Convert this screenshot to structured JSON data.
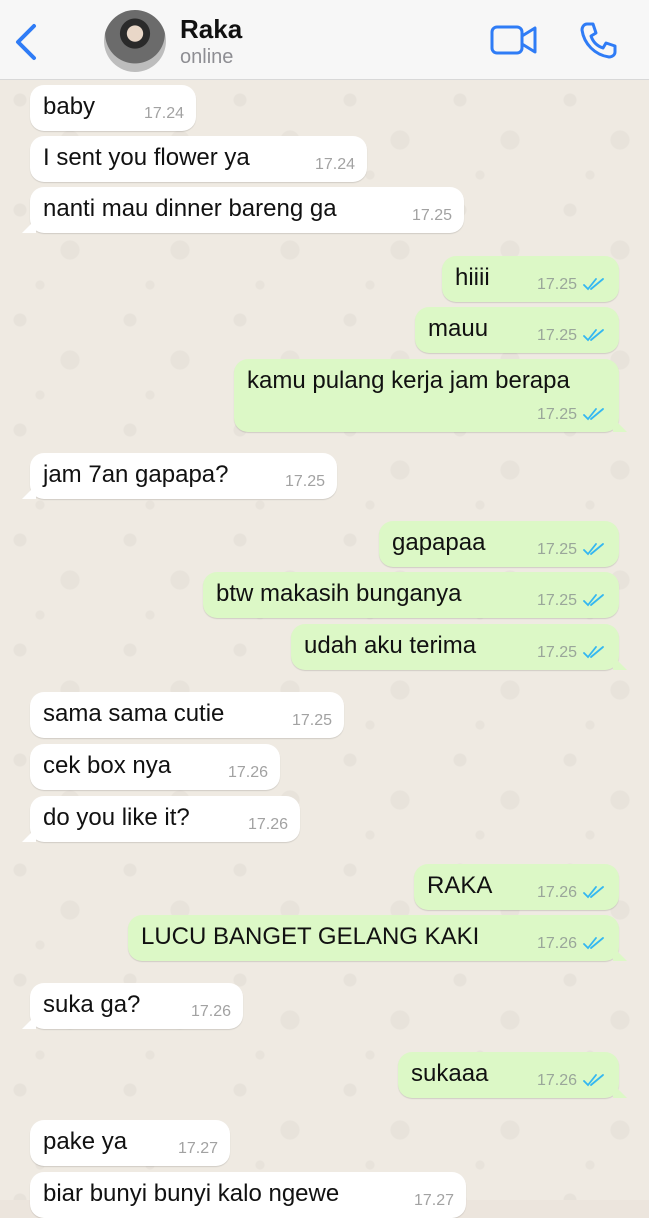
{
  "header": {
    "contact_name": "Raka",
    "status": "online"
  },
  "colors": {
    "accent": "#2F7CF6",
    "incoming_bubble": "#FFFFFF",
    "outgoing_bubble": "#DCF8C6",
    "read_ticks": "#34B7F1",
    "wallpaper": "#EFEAE2"
  },
  "messages": [
    {
      "dir": "in",
      "text": "baby",
      "time": "17.24"
    },
    {
      "dir": "in",
      "text": "I sent you flower ya",
      "time": "17.24"
    },
    {
      "dir": "in",
      "text": "nanti mau dinner bareng ga",
      "time": "17.25"
    },
    {
      "dir": "out",
      "text": "hiiii",
      "time": "17.25",
      "status": "read"
    },
    {
      "dir": "out",
      "text": "mauu",
      "time": "17.25",
      "status": "read"
    },
    {
      "dir": "out",
      "text": "kamu pulang kerja jam berapa",
      "time": "17.25",
      "status": "read"
    },
    {
      "dir": "in",
      "text": "jam 7an gapapa?",
      "time": "17.25"
    },
    {
      "dir": "out",
      "text": "gapapaa",
      "time": "17.25",
      "status": "read"
    },
    {
      "dir": "out",
      "text": "btw makasih bunganya",
      "time": "17.25",
      "status": "read"
    },
    {
      "dir": "out",
      "text": "udah aku terima",
      "time": "17.25",
      "status": "read"
    },
    {
      "dir": "in",
      "text": "sama sama cutie",
      "time": "17.25"
    },
    {
      "dir": "in",
      "text": "cek box nya",
      "time": "17.26"
    },
    {
      "dir": "in",
      "text": "do you like it?",
      "time": "17.26"
    },
    {
      "dir": "out",
      "text": "RAKA",
      "time": "17.26",
      "status": "read"
    },
    {
      "dir": "out",
      "text": "LUCU BANGET GELANG KAKI",
      "time": "17.26",
      "status": "read"
    },
    {
      "dir": "in",
      "text": "suka ga?",
      "time": "17.26"
    },
    {
      "dir": "out",
      "text": "sukaaa",
      "time": "17.26",
      "status": "read"
    },
    {
      "dir": "in",
      "text": "pake ya",
      "time": "17.27"
    },
    {
      "dir": "in",
      "text": "biar bunyi bunyi kalo ngewe",
      "time": "17.27"
    }
  ]
}
